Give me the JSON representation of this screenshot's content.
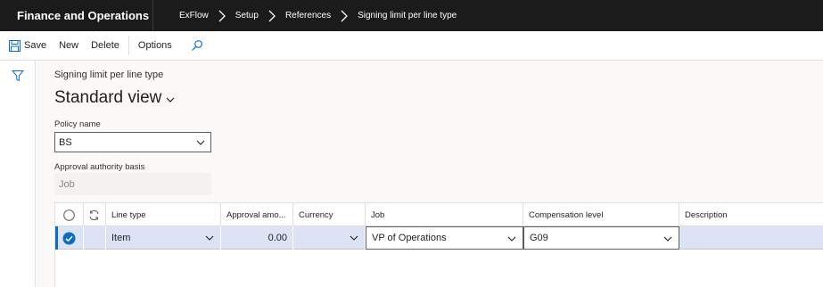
{
  "app": {
    "title": "Finance and Operations"
  },
  "breadcrumb": [
    "ExFlow",
    "Setup",
    "References",
    "Signing limit per line type"
  ],
  "actions": {
    "save": "Save",
    "new": "New",
    "delete": "Delete",
    "options": "Options"
  },
  "page": {
    "subtitle": "Signing limit per line type",
    "view": "Standard view"
  },
  "policy": {
    "label": "Policy name",
    "value": "BS"
  },
  "authority": {
    "label": "Approval authority basis",
    "value": "Job"
  },
  "grid": {
    "columns": [
      "Line type",
      "Approval amo...",
      "Currency",
      "Job",
      "Compensation level",
      "Description"
    ],
    "rows": [
      {
        "line_type": "Item",
        "approval_amount": "0.00",
        "currency": "",
        "job": "VP of Operations",
        "compensation_level": "G09",
        "description": ""
      }
    ]
  },
  "colors": {
    "topbar": "#1b1b1b",
    "accent": "#0f6cbd",
    "row_selected": "#dce3f5"
  }
}
